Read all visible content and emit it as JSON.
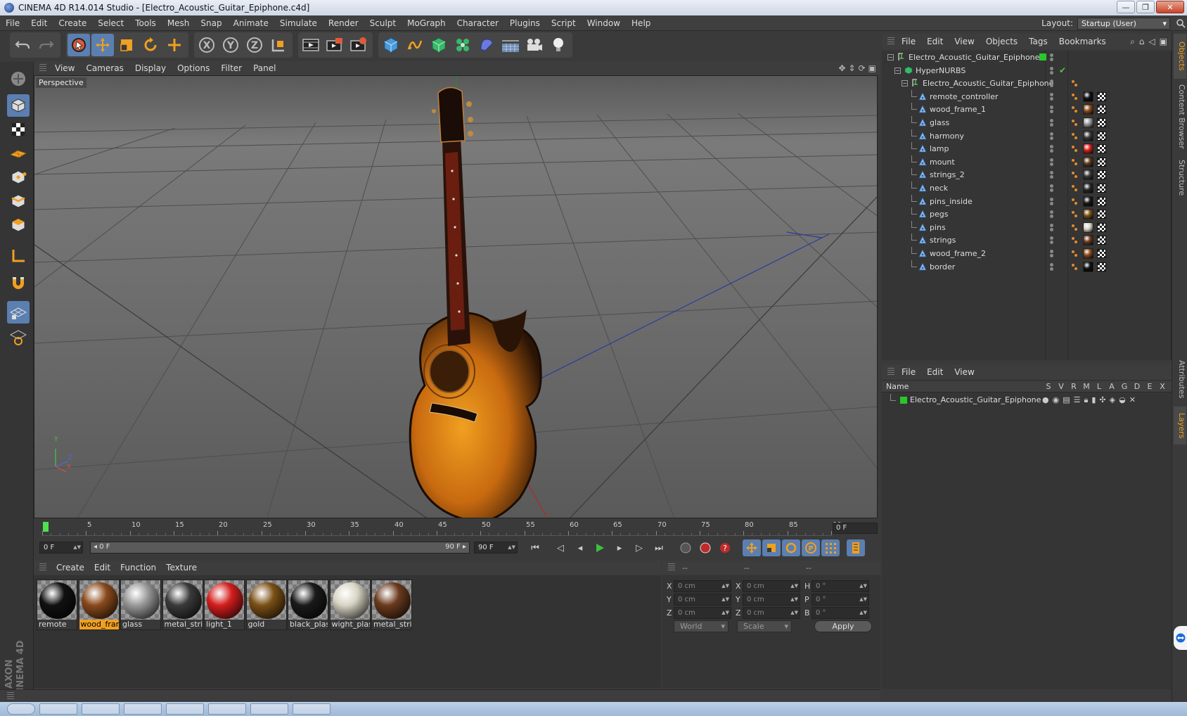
{
  "window": {
    "title": "CINEMA 4D R14.014 Studio - [Electro_Acoustic_Guitar_Epiphone.c4d]",
    "minimize": "—",
    "restore": "❐",
    "close": "✕"
  },
  "menubar": {
    "items": [
      "File",
      "Edit",
      "Create",
      "Select",
      "Tools",
      "Mesh",
      "Snap",
      "Animate",
      "Simulate",
      "Render",
      "Sculpt",
      "MoGraph",
      "Character",
      "Plugins",
      "Script",
      "Window",
      "Help"
    ],
    "layout_label": "Layout:",
    "layout_value": "Startup (User)"
  },
  "viewport": {
    "menu": [
      "View",
      "Cameras",
      "Display",
      "Options",
      "Filter",
      "Panel"
    ],
    "label": "Perspective",
    "axis_y": "Y",
    "axis_z": "Z",
    "axis_x": "X"
  },
  "timeline": {
    "ticks": [
      "0",
      "5",
      "10",
      "15",
      "20",
      "25",
      "30",
      "35",
      "40",
      "45",
      "50",
      "55",
      "60",
      "65",
      "70",
      "75",
      "80",
      "85",
      "90"
    ],
    "current_frame": "0 F"
  },
  "transport": {
    "start_frame": "0 F",
    "range_start": "0 F",
    "range_end": "90 F",
    "end_frame": "90 F"
  },
  "materials": {
    "menu": [
      "Create",
      "Edit",
      "Function",
      "Texture"
    ],
    "items": [
      {
        "label": "remote",
        "color": "#111111",
        "selected": false
      },
      {
        "label": "wood_fram",
        "color": "#8a4a1c",
        "selected": true
      },
      {
        "label": "glass",
        "color": "#9a9a9a",
        "selected": false
      },
      {
        "label": "metal_strin",
        "color": "#3a3a3a",
        "selected": false
      },
      {
        "label": "light_1",
        "color": "#d41e1e",
        "selected": false
      },
      {
        "label": "gold",
        "color": "#7a5016",
        "selected": false
      },
      {
        "label": "black_plast",
        "color": "#1a1a1a",
        "selected": false
      },
      {
        "label": "wight_plas",
        "color": "#d8d4c4",
        "selected": false
      },
      {
        "label": "metal_strin",
        "color": "#6a3a1e",
        "selected": false
      }
    ]
  },
  "coordinates": {
    "header": [
      "--",
      "--",
      "--"
    ],
    "pos": [
      {
        "axis": "X",
        "value": "0 cm"
      },
      {
        "axis": "Y",
        "value": "0 cm"
      },
      {
        "axis": "Z",
        "value": "0 cm"
      }
    ],
    "size": [
      {
        "axis": "X",
        "value": "0 cm"
      },
      {
        "axis": "Y",
        "value": "0 cm"
      },
      {
        "axis": "Z",
        "value": "0 cm"
      }
    ],
    "rot": [
      {
        "axis": "H",
        "value": "0 °"
      },
      {
        "axis": "P",
        "value": "0 °"
      },
      {
        "axis": "B",
        "value": "0 °"
      }
    ],
    "space": "World",
    "mode": "Scale",
    "apply": "Apply"
  },
  "objects": {
    "menu": [
      "File",
      "Edit",
      "View",
      "Objects",
      "Tags",
      "Bookmarks"
    ],
    "rows": [
      {
        "name": "Electro_Acoustic_Guitar_Epiphone",
        "level": 0,
        "type": "null"
      },
      {
        "name": "HyperNURBS",
        "level": 1,
        "type": "nurbs"
      },
      {
        "name": "Electro_Acoustic_Guitar_Epiphone",
        "level": 2,
        "type": "null"
      },
      {
        "name": "remote_controller",
        "level": 3,
        "type": "poly",
        "mat": "#111111"
      },
      {
        "name": "wood_frame_1",
        "level": 3,
        "type": "poly",
        "mat": "#8a4a1c"
      },
      {
        "name": "glass",
        "level": 3,
        "type": "poly",
        "mat": "#9a9a9a"
      },
      {
        "name": "harmony",
        "level": 3,
        "type": "poly",
        "mat": "#3a3a3a"
      },
      {
        "name": "lamp",
        "level": 3,
        "type": "poly",
        "mat": "#d41e1e"
      },
      {
        "name": "mount",
        "level": 3,
        "type": "poly",
        "mat": "#5a3a1c"
      },
      {
        "name": "strings_2",
        "level": 3,
        "type": "poly",
        "mat": "#3a3a3a"
      },
      {
        "name": "neck",
        "level": 3,
        "type": "poly",
        "mat": "#2a2a2a"
      },
      {
        "name": "pins_inside",
        "level": 3,
        "type": "poly",
        "mat": "#1a1a1a"
      },
      {
        "name": "pegs",
        "level": 3,
        "type": "poly",
        "mat": "#7a5016"
      },
      {
        "name": "pins",
        "level": 3,
        "type": "poly",
        "mat": "#d8d4c4"
      },
      {
        "name": "strings",
        "level": 3,
        "type": "poly",
        "mat": "#6a3a1e"
      },
      {
        "name": "wood_frame_2",
        "level": 3,
        "type": "poly",
        "mat": "#8a4a1c"
      },
      {
        "name": "border",
        "level": 3,
        "type": "poly",
        "mat": "#111111"
      }
    ]
  },
  "layers": {
    "menu": [
      "File",
      "Edit",
      "View"
    ],
    "header_name": "Name",
    "columns": [
      "S",
      "V",
      "R",
      "M",
      "L",
      "A",
      "G",
      "D",
      "E",
      "X"
    ],
    "row_name": "Electro_Acoustic_Guitar_Epiphone"
  },
  "sidetabs": [
    "Objects",
    "Content Browser",
    "Structure",
    "Attributes",
    "Layers"
  ],
  "logo": {
    "lines": [
      "MAXON",
      "CINEMA 4D"
    ]
  },
  "colors": {
    "accent": "#5b7fb0",
    "selection": "#f0a020",
    "layer_green": "#28c828"
  }
}
